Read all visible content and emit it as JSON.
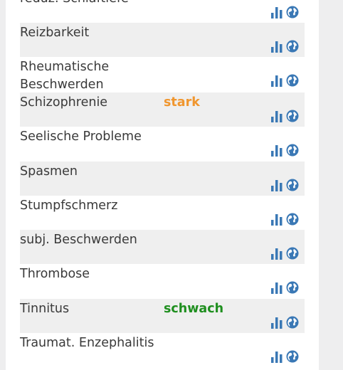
{
  "colors": {
    "icon_blue": "#3a78b5",
    "strong": "#f0962e",
    "weak": "#1f8f1f",
    "text": "#3a3a3a",
    "stripe": "#efefef"
  },
  "icons": {
    "chart": "bar-chart-icon",
    "globe": "globe-icon"
  },
  "rows": [
    {
      "name": "reduz. Schlaftiefe",
      "strength": "",
      "shaded": false
    },
    {
      "name": "Reizbarkeit",
      "strength": "",
      "shaded": true
    },
    {
      "name": "Rheumatische\nBeschwerden",
      "strength": "",
      "shaded": false
    },
    {
      "name": "Schizophrenie",
      "strength": "stark",
      "level": "strong",
      "shaded": true
    },
    {
      "name": "Seelische Probleme",
      "strength": "",
      "shaded": false
    },
    {
      "name": "Spasmen",
      "strength": "",
      "shaded": true
    },
    {
      "name": "Stumpfschmerz",
      "strength": "",
      "shaded": false
    },
    {
      "name": "subj. Beschwerden",
      "strength": "",
      "shaded": true
    },
    {
      "name": "Thrombose",
      "strength": "",
      "shaded": false
    },
    {
      "name": "Tinnitus",
      "strength": "schwach",
      "level": "weak",
      "shaded": true
    },
    {
      "name": "Traumat. Enzephalitis",
      "strength": "",
      "shaded": false
    }
  ]
}
